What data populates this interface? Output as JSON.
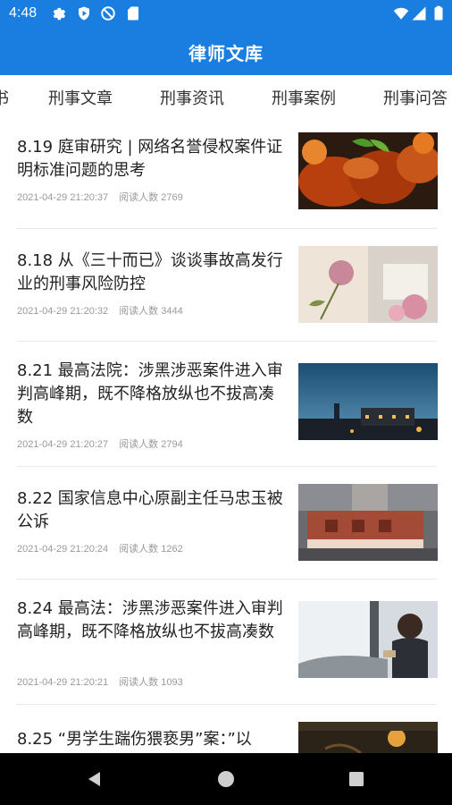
{
  "status_bar": {
    "time": "4:48",
    "left_icons": [
      "gear-icon",
      "shield-icon",
      "no-sync-icon",
      "sd-card-icon"
    ],
    "right_icons": [
      "wifi-icon",
      "signal-icon",
      "battery-icon"
    ]
  },
  "app": {
    "title": "律师文库",
    "accent": "#1a7ee0"
  },
  "tabs": [
    "书",
    "刑事文章",
    "刑事资讯",
    "刑事案例",
    "刑事问答"
  ],
  "articles": [
    {
      "title": "8.19 庭审研究 | 网络名誉侵权案件证明标准问题的思考",
      "date": "2021-04-29 21:20:37",
      "reads": "阅读人数 2769",
      "image": "food-photo"
    },
    {
      "title": "8.18 从《三十而已》谈谈事故高发行业的刑事风险防控",
      "date": "2021-04-29 21:20:32",
      "reads": "阅读人数 3444",
      "image": "flowers-photo"
    },
    {
      "title": "8.21 最高法院：涉黑涉恶案件进入审判高峰期，既不降格放纵也不拔高凑数",
      "date": "2021-04-29 21:20:27",
      "reads": "阅读人数 2794",
      "image": "night-city-photo"
    },
    {
      "title": "8.22 国家信息中心原副主任马忠玉被公诉",
      "date": "2021-04-29 21:20:24",
      "reads": "阅读人数 1262",
      "image": "street-sign-photo"
    },
    {
      "title": "8.24 最高法：涉黑涉恶案件进入审判高峰期，既不降格放纵也不拔高凑数",
      "date": "2021-04-29 21:20:21",
      "reads": "阅读人数 1093",
      "image": "woman-reading-photo"
    },
    {
      "title": "8.25 “男学生踹伤猥亵男”案：”以",
      "date": "",
      "reads": "",
      "image": "sunset-photo"
    }
  ],
  "nav_bar": {
    "buttons": [
      "back-icon",
      "home-icon",
      "recents-icon"
    ]
  }
}
